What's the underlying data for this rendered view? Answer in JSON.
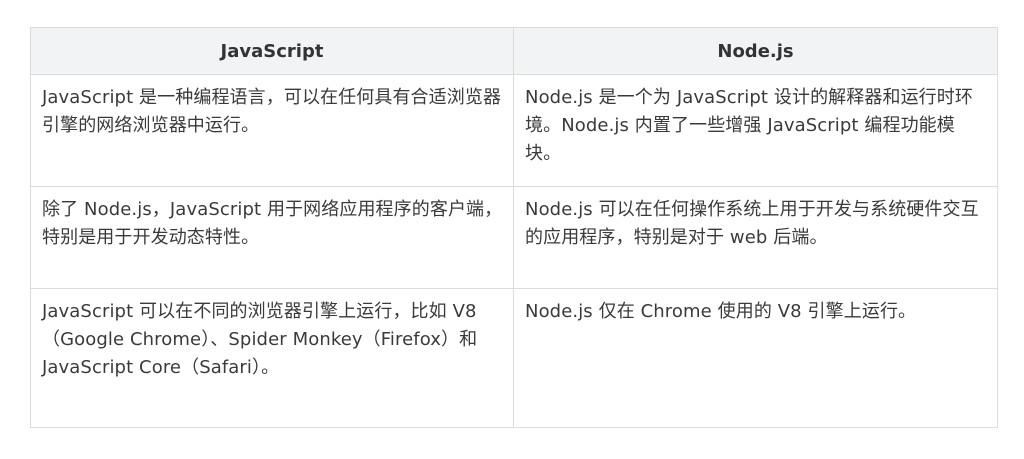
{
  "table": {
    "headers": [
      "JavaScript",
      "Node.js"
    ],
    "rows": [
      [
        "JavaScript 是一种编程语言，可以在任何具有合适浏览器引擎的网络浏览器中运行。",
        "Node.js 是一个为 JavaScript 设计的解释器和运行时环境。Node.js 内置了一些增强 JavaScript 编程功能模块。"
      ],
      [
        "除了 Node.js，JavaScript 用于网络应用程序的客户端，特别是用于开发动态特性。",
        "Node.js 可以在任何操作系统上用于开发与系统硬件交互的应用程序，特别是对于 web 后端。"
      ],
      [
        "JavaScript 可以在不同的浏览器引擎上运行，比如 V8（Google Chrome）、Spider Monkey（Firefox）和JavaScript Core（Safari）。",
        "Node.js 仅在 Chrome 使用的 V8 引擎上运行。"
      ]
    ]
  }
}
